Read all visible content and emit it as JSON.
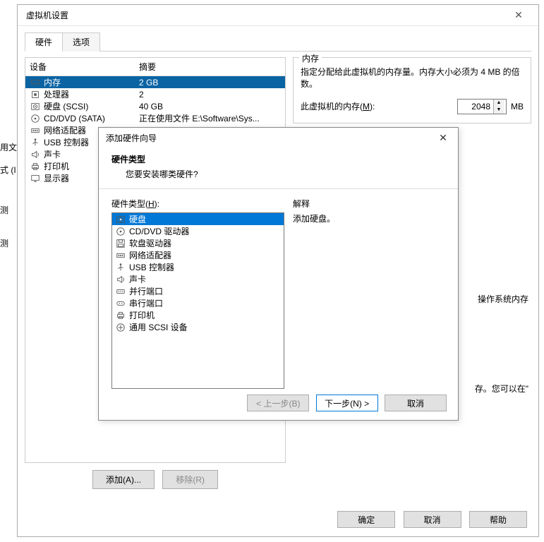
{
  "left_fragments": [
    "用文",
    "式 (I",
    "测",
    "测"
  ],
  "window": {
    "title": "虚拟机设置",
    "tabs": [
      "硬件",
      "选项"
    ],
    "active_tab": 0,
    "device_header": {
      "name": "设备",
      "summary": "摘要"
    },
    "devices": [
      {
        "icon": "memory",
        "name": "内存",
        "summary": "2 GB",
        "selected": true
      },
      {
        "icon": "cpu",
        "name": "处理器",
        "summary": "2"
      },
      {
        "icon": "disk",
        "name": "硬盘 (SCSI)",
        "summary": "40 GB"
      },
      {
        "icon": "cd",
        "name": "CD/DVD (SATA)",
        "summary": "正在使用文件 E:\\Software\\Sys..."
      },
      {
        "icon": "network",
        "name": "网络适配器",
        "summary": ""
      },
      {
        "icon": "usb",
        "name": "USB 控制器",
        "summary": ""
      },
      {
        "icon": "sound",
        "name": "声卡",
        "summary": ""
      },
      {
        "icon": "printer",
        "name": "打印机",
        "summary": ""
      },
      {
        "icon": "display",
        "name": "显示器",
        "summary": ""
      }
    ],
    "add_button": "添加(A)...",
    "remove_button": "移除(R)",
    "memory_group": {
      "title": "内存",
      "desc": "指定分配给此虚拟机的内存量。内存大小必须为 4 MB 的倍数。",
      "label_pre": "此虚拟机的内存(",
      "label_hot": "M",
      "label_post": "):",
      "value": "2048",
      "unit": "MB"
    },
    "right_fragments": [
      "操作系统内存",
      "存。您可以在\""
    ],
    "ok": "确定",
    "cancel": "取消",
    "help": "帮助"
  },
  "wizard": {
    "title": "添加硬件向导",
    "header": "硬件类型",
    "subheader": "您要安装哪类硬件?",
    "list_label_pre": "硬件类型(",
    "list_label_hot": "H",
    "list_label_post": "):",
    "items": [
      {
        "icon": "disk",
        "label": "硬盘",
        "selected": true
      },
      {
        "icon": "cd",
        "label": "CD/DVD 驱动器"
      },
      {
        "icon": "floppy",
        "label": "软盘驱动器"
      },
      {
        "icon": "network",
        "label": "网络适配器"
      },
      {
        "icon": "usb",
        "label": "USB 控制器"
      },
      {
        "icon": "sound",
        "label": "声卡"
      },
      {
        "icon": "parallel",
        "label": "并行端口"
      },
      {
        "icon": "serial",
        "label": "串行端口"
      },
      {
        "icon": "printer",
        "label": "打印机"
      },
      {
        "icon": "scsi",
        "label": "通用 SCSI 设备"
      }
    ],
    "explain_label": "解释",
    "explain_text": "添加硬盘。",
    "back": "< 上一步(B)",
    "next": "下一步(N) >",
    "cancel": "取消"
  }
}
